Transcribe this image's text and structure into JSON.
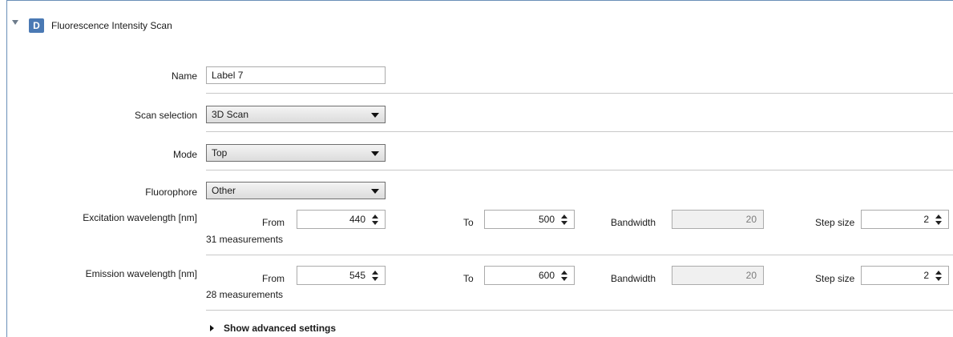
{
  "header": {
    "badge": "D",
    "title": "Fluorescence Intensity Scan"
  },
  "fields": {
    "name": {
      "label": "Name",
      "value": "Label 7"
    },
    "scan_selection": {
      "label": "Scan selection",
      "value": "3D Scan"
    },
    "mode": {
      "label": "Mode",
      "value": "Top"
    },
    "fluorophore": {
      "label": "Fluorophore",
      "value": "Other"
    }
  },
  "excitation": {
    "label": "Excitation wavelength [nm]",
    "from_label": "From",
    "from_value": "440",
    "to_label": "To",
    "to_value": "500",
    "bandwidth_label": "Bandwidth",
    "bandwidth_value": "20",
    "step_label": "Step size",
    "step_value": "2",
    "measurements": "31 measurements"
  },
  "emission": {
    "label": "Emission wavelength [nm]",
    "from_label": "From",
    "from_value": "545",
    "to_label": "To",
    "to_value": "600",
    "bandwidth_label": "Bandwidth",
    "bandwidth_value": "20",
    "step_label": "Step size",
    "step_value": "2",
    "measurements": "28 measurements"
  },
  "advanced": {
    "label": "Show advanced settings"
  },
  "icons": {
    "collapse": "triangle-down-icon",
    "expand": "triangle-right-icon",
    "spin": "spin-arrows-icon"
  }
}
